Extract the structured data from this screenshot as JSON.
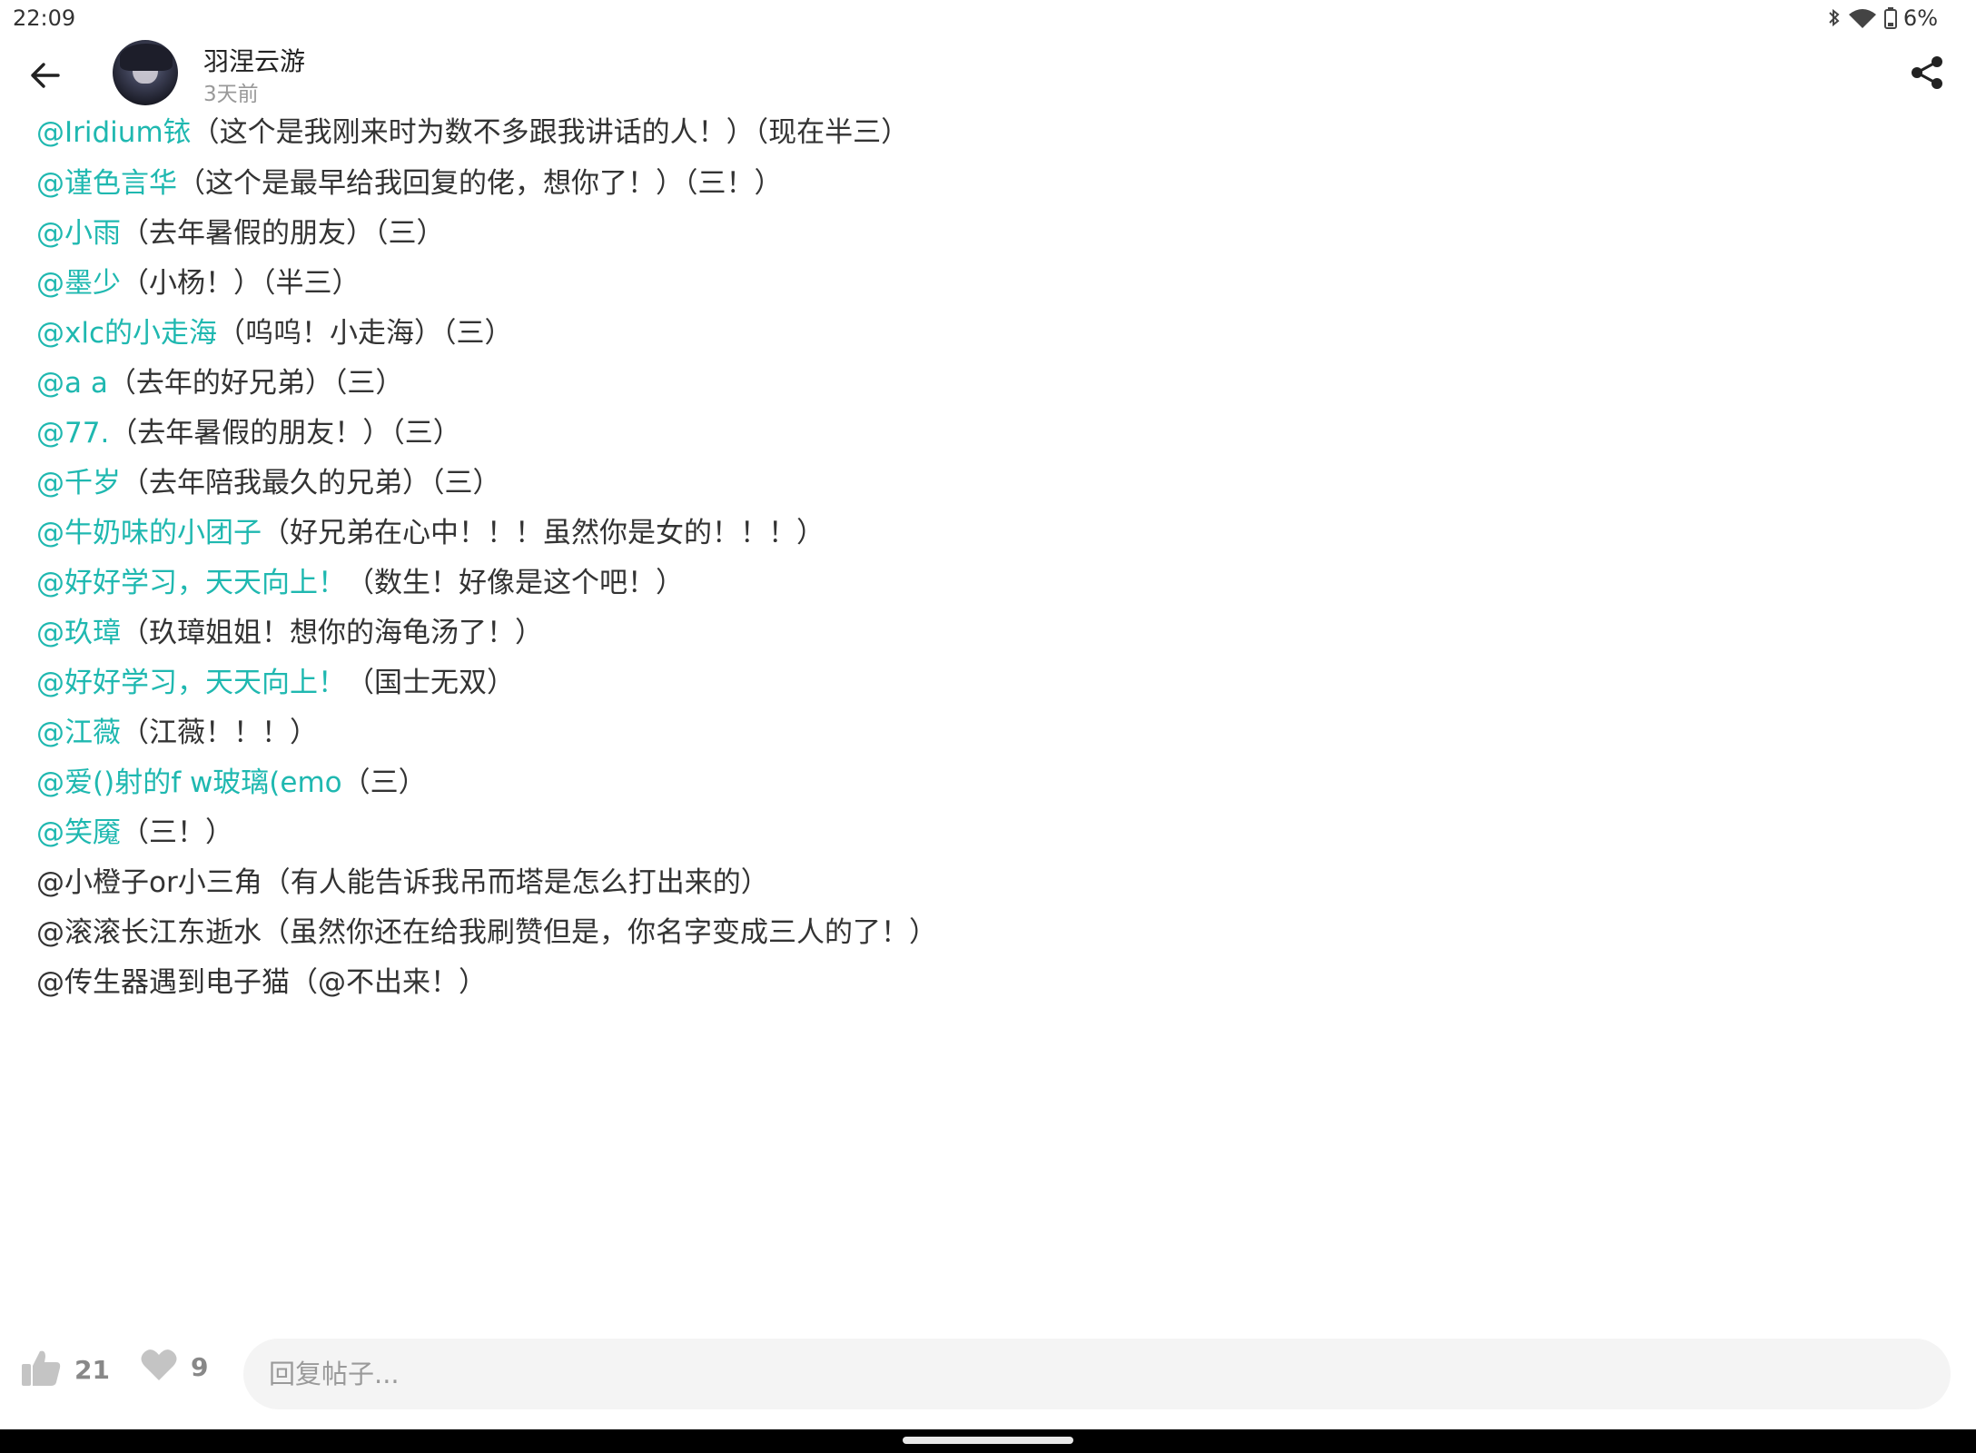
{
  "status": {
    "time": "22:09",
    "battery": "6%",
    "icons": [
      "bluetooth-icon",
      "wifi-icon",
      "battery-icon"
    ]
  },
  "header": {
    "author_name": "羽涅云游",
    "post_time": "3天前",
    "back_icon": "arrow-left-icon",
    "share_icon": "share-icon"
  },
  "content": {
    "lines": [
      {
        "mention": "@Iridium铱",
        "text": "（这个是我刚来时为数不多跟我讲话的人！）（现在半三）"
      },
      {
        "mention": "@谨色言华",
        "text": "（这个是最早给我回复的佬，想你了！）（三！）"
      },
      {
        "mention": "@小雨",
        "text": "（去年暑假的朋友）（三）"
      },
      {
        "mention": "@墨少",
        "text": "（小杨！）（半三）"
      },
      {
        "mention": "@xlc的小走海",
        "text": "（呜呜！小走海）（三）"
      },
      {
        "mention": "@a a",
        "text": "（去年的好兄弟）（三）"
      },
      {
        "mention": "@77.",
        "text": "（去年暑假的朋友！）（三）"
      },
      {
        "mention": "@千岁",
        "text": "（去年陪我最久的兄弟）（三）"
      },
      {
        "mention": "@牛奶味的小团子",
        "text": "（好兄弟在心中！！！虽然你是女的！！！）"
      },
      {
        "mention": "@好好学习，天天向上！",
        "text": "（数生！好像是这个吧！）"
      },
      {
        "mention": "@玖璋",
        "text": "（玖璋姐姐！想你的海龟汤了！）"
      },
      {
        "mention": "@好好学习，天天向上！",
        "text": "（国士无双）"
      },
      {
        "mention": "@江薇",
        "text": "（江薇！！！）"
      },
      {
        "mention": "@爱()射的f w玻璃(emo",
        "text": "（三）"
      },
      {
        "mention": "@笑魇",
        "text": "（三！）"
      },
      {
        "mention": "",
        "text": "@小橙子or小三角（有人能告诉我吊而塔是怎么打出来的）"
      },
      {
        "mention": "",
        "text": "@滚滚长江东逝水（虽然你还在给我刷赞但是，你名字变成三人的了！）"
      },
      {
        "mention": "",
        "text": "@传生器遇到电子猫（@不出来！）"
      }
    ]
  },
  "bottom": {
    "like_count": "21",
    "fav_count": "9",
    "reply_placeholder": "回复帖子...",
    "reply_value": "",
    "like_icon": "thumbs-up-icon",
    "fav_icon": "heart-icon"
  }
}
